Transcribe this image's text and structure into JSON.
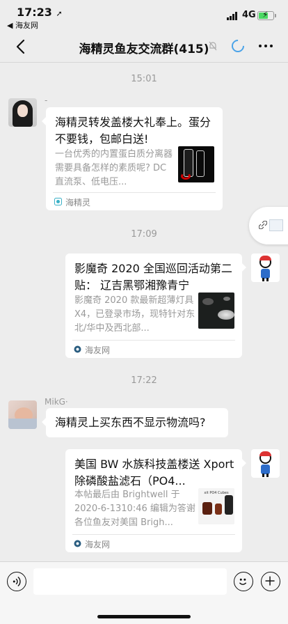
{
  "status_bar": {
    "time": "17:23",
    "location_arrow": "➚",
    "back_app": "◀ 海友网",
    "network": "4G"
  },
  "nav": {
    "title": "海精灵鱼友交流群(415)",
    "icons": [
      "back-icon",
      "mute-bell-icon",
      "loading-ring-icon",
      "more-icon"
    ]
  },
  "messages": [
    {
      "type": "timestamp",
      "text": "15:01"
    },
    {
      "type": "card",
      "side": "left",
      "sender": "-",
      "avatar": "girl-avatar",
      "title": "海精灵转发盖楼大礼奉上。蛋分不要钱，包邮白送!",
      "desc": "一台优秀的内置蛋白质分离器需要具备怎样的素质呢? DC直流泵、低电压...",
      "source": "海精灵"
    },
    {
      "type": "timestamp",
      "text": "17:09"
    },
    {
      "type": "card",
      "side": "right",
      "avatar": "cartoon-avatar",
      "title": "影魔奇 2020 全国巡回活动第二贴：  辽吉黑鄂湘豫青宁",
      "desc": "影魔奇 2020 款最新超薄灯具 X4，已登录市场，现特针对东北/华中及西北部...",
      "source": "海友网"
    },
    {
      "type": "timestamp",
      "text": "17:22"
    },
    {
      "type": "text",
      "side": "left",
      "sender": "MikG·",
      "avatar": "baby-avatar",
      "text": "海精灵上买东西不显示物流吗?"
    },
    {
      "type": "card",
      "side": "right",
      "avatar": "cartoon-avatar",
      "title": "美国 BW 水族科技盖楼送 Xport 除磷酸盐滤石（PO4...",
      "desc": "本帖最后由 Brightwell 于 2020-6-1310:46 编辑为答谢各位鱼友对美国 Brigh...",
      "source": "海友网",
      "thumb_caption": "xit PO4 Cubes"
    }
  ],
  "input_bar": {
    "value": "",
    "placeholder": ""
  }
}
